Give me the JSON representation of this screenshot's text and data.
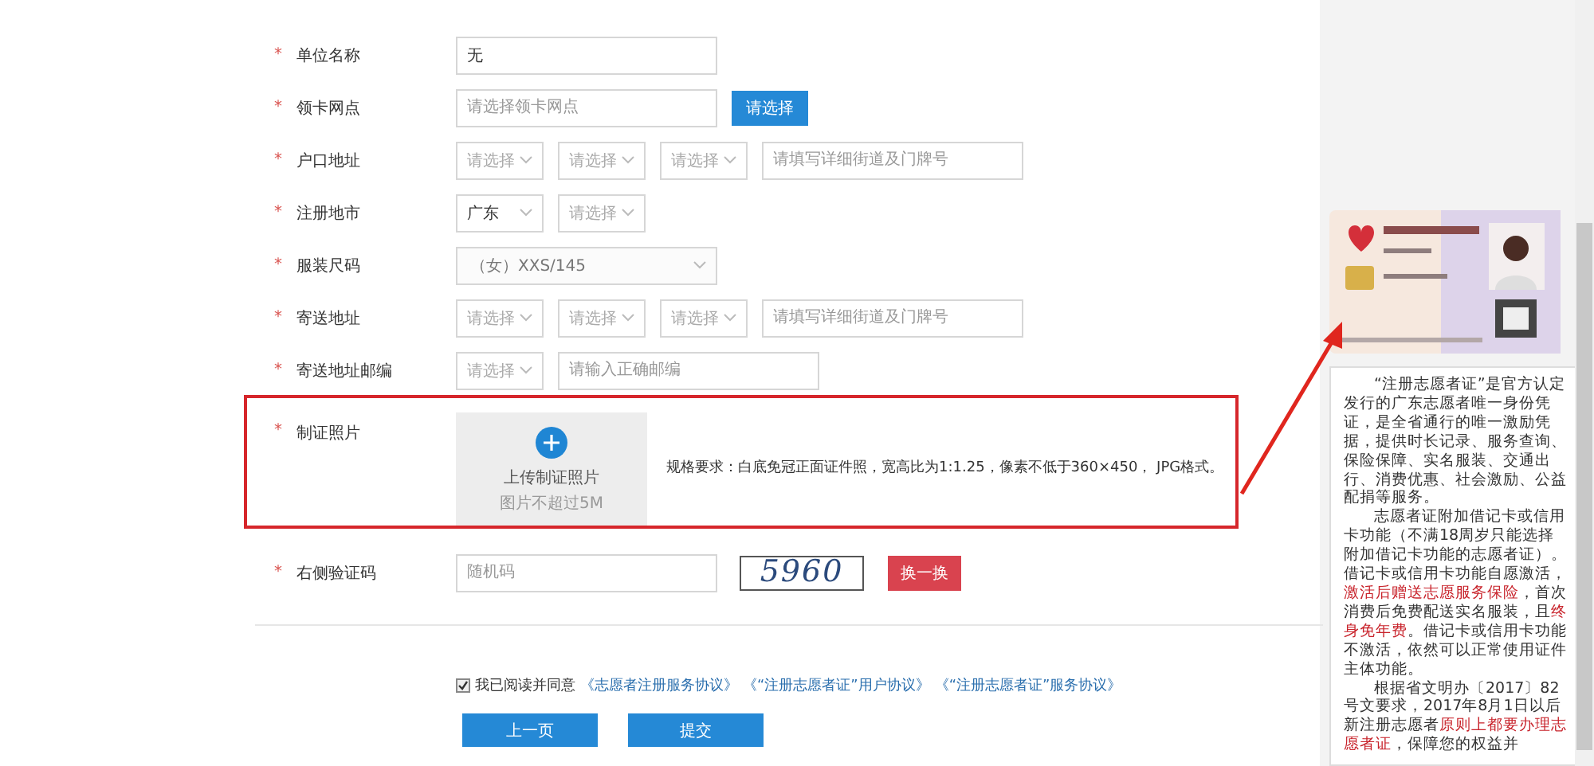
{
  "form": {
    "rows": [
      {
        "label": "单位名称",
        "mark": "*",
        "controls": [
          {
            "kind": "input",
            "value": "无"
          }
        ]
      },
      {
        "label": "领卡网点",
        "mark": "*",
        "controls": [
          {
            "kind": "input",
            "placeholder": "请选择领卡网点"
          },
          {
            "kind": "button",
            "label": "请选择"
          }
        ]
      },
      {
        "label": "户口地址",
        "mark": "*",
        "controls": [
          {
            "kind": "select",
            "placeholder": "请选择"
          },
          {
            "kind": "select",
            "placeholder": "请选择"
          },
          {
            "kind": "select",
            "placeholder": "请选择"
          },
          {
            "kind": "input",
            "placeholder": "请填写详细街道及门牌号"
          }
        ]
      },
      {
        "label": "注册地市",
        "mark": "*",
        "controls": [
          {
            "kind": "select",
            "value": "广东"
          },
          {
            "kind": "select",
            "placeholder": "请选择"
          }
        ]
      },
      {
        "label": "服装尺码",
        "mark": "*",
        "controls": [
          {
            "kind": "wide-select",
            "value": "（女）XXS/145",
            "disabled": true
          }
        ]
      },
      {
        "label": "寄送地址",
        "mark": "*",
        "controls": [
          {
            "kind": "select",
            "placeholder": "请选择"
          },
          {
            "kind": "select",
            "placeholder": "请选择"
          },
          {
            "kind": "select",
            "placeholder": "请选择"
          },
          {
            "kind": "input",
            "placeholder": "请填写详细街道及门牌号"
          }
        ]
      },
      {
        "label": "寄送地址邮编",
        "mark": "*",
        "controls": [
          {
            "kind": "select",
            "placeholder": "请选择"
          },
          {
            "kind": "input",
            "placeholder": "请输入正确邮编"
          }
        ]
      }
    ],
    "photo": {
      "label": "制证照片",
      "mark": "*",
      "upload_title": "上传制证照片",
      "upload_hint": "图片不超过5M",
      "spec": "规格要求：白底免冠正面证件照，宽高比为1:1.25，像素不低于360×450， JPG格式。"
    },
    "captcha": {
      "label": "右侧验证码",
      "mark": "*",
      "placeholder": "随机码",
      "code": "5960",
      "refresh": "换一换"
    },
    "agreement": {
      "checked": true,
      "text": "我已阅读并同意",
      "links": [
        "《志愿者注册服务协议》",
        "《“注册志愿者证”用户协议》",
        "《“注册志愿者证”服务协议》"
      ]
    },
    "buttons": [
      {
        "label": "上一页"
      },
      {
        "label": "提交"
      }
    ]
  },
  "sidebar": {
    "card": {
      "kind": "picture"
    },
    "paragraphs": [
      [
        {
          "text": "“注册志愿者证”是官方认定发行的广东志愿者唯一身份凭证，是全省通行的唯一激励凭据，提供时长记录、服务查询、保险保障、实名服装、交通出行、消费优惠、社会激励、公益配捐等服务。",
          "highlight": false
        }
      ],
      [
        {
          "text": "志愿者证附加借记卡或信用卡功能（不满18周岁只能选择附加借记卡功能的志愿者证）。借记卡或信用卡功能自愿激活，",
          "highlight": false
        },
        {
          "text": "激活后赠送志愿服务保险",
          "highlight": true
        },
        {
          "text": "，首次消费后免费配送实名服装，且",
          "highlight": false
        },
        {
          "text": "终身免年费",
          "highlight": true
        },
        {
          "text": "。借记卡或信用卡功能不激活，依然可以正常使用证件主体功能。",
          "highlight": false
        }
      ],
      [
        {
          "text": "根据省文明办〔2017〕82号文要求，2017年8月1日以后新注册志愿者",
          "highlight": false
        },
        {
          "text": "原则上都要办理志愿者证",
          "highlight": true
        },
        {
          "text": "，保障您的权益并",
          "highlight": false
        }
      ]
    ]
  }
}
